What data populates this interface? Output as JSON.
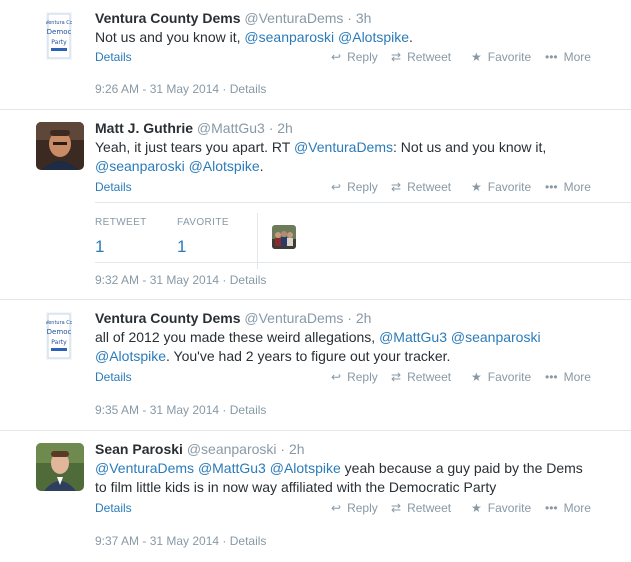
{
  "actions": {
    "details": "Details",
    "reply": "Reply",
    "retweet": "Retweet",
    "favorite": "Favorite",
    "more": "More"
  },
  "logo_text": "Ventura Co Democ Party",
  "tweets": [
    {
      "name": "Ventura County Dems",
      "handle": "@VenturaDems",
      "sep": " · ",
      "time": "3h",
      "text_parts": [
        "Not us and you know it, ",
        "@seanparoski",
        " ",
        "@Alotspike",
        "."
      ],
      "stamp": "9:26 AM - 31 May 2014 · Details"
    },
    {
      "name": "Matt J. Guthrie",
      "handle": "@MattGu3",
      "sep": " · ",
      "time": "2h",
      "text": {
        "a": "Yeah, it just tears you apart. RT ",
        "m1": "@VenturaDems",
        "b": ": Not us and you know it,",
        "m2": "@seanparoski",
        "c": " ",
        "m3": "@Alotspike",
        "d": "."
      },
      "stats": {
        "retweet_label": "RETWEET",
        "retweet_count": "1",
        "favorite_label": "FAVORITE",
        "favorite_count": "1"
      },
      "stamp": "9:32 AM - 31 May 2014 · Details"
    },
    {
      "name": "Ventura County Dems",
      "handle": "@VenturaDems",
      "sep": " · ",
      "time": "2h",
      "text": {
        "a": "all of 2012 you made these weird allegations, ",
        "m1": "@MattGu3",
        "b": " ",
        "m2": "@seanparoski",
        "m3": "@Alotspike",
        "c": ". You've had 2 years to figure out your tracker."
      },
      "stamp": "9:35 AM - 31 May 2014 · Details"
    },
    {
      "name": "Sean Paroski",
      "handle": "@seanparoski",
      "sep": " · ",
      "time": "2h",
      "text": {
        "m1": "@VenturaDems",
        "a": " ",
        "m2": "@MattGu3",
        "b": " ",
        "m3": "@Alotspike",
        "c": " yeah because a guy paid by the Dems",
        "d": "to film little kids is in now way affiliated with the Democratic Party"
      },
      "stamp": "9:37 AM - 31 May 2014 · Details"
    }
  ]
}
